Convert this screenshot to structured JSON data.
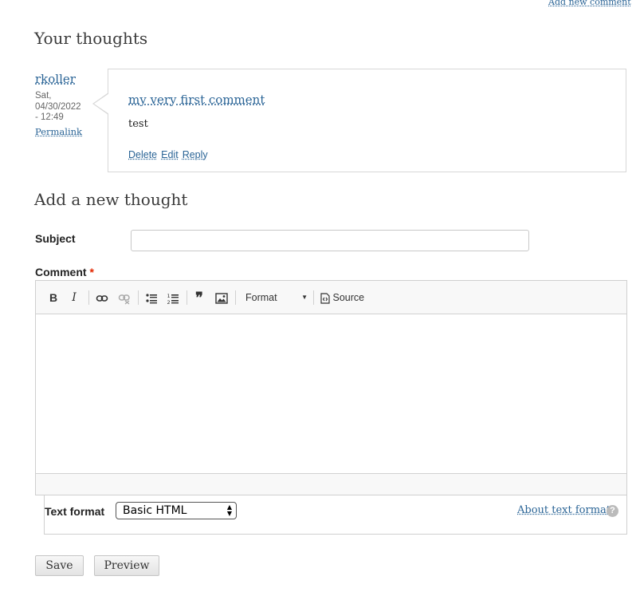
{
  "header": {
    "add_new_comment": "Add new comment"
  },
  "comments_section": {
    "title": "Your thoughts",
    "comment": {
      "author": "rkoller",
      "date_lines": [
        "Sat,",
        "04/30/2022",
        "- 12:49"
      ],
      "permalink": "Permalink",
      "title": "my very first comment",
      "body": "test",
      "actions": {
        "delete": "Delete",
        "edit": "Edit",
        "reply": "Reply"
      }
    }
  },
  "form": {
    "title": "Add a new thought",
    "subject_label": "Subject",
    "subject_value": "",
    "comment_label": "Comment",
    "required_marker": "*",
    "toolbar": {
      "bold": "B",
      "italic": "I",
      "format": "Format",
      "source": "Source",
      "blockquote": "❞"
    },
    "text_format_label": "Text format",
    "text_format_value": "Basic HTML",
    "about_text_formats": "About text formats",
    "help_glyph": "?",
    "save": "Save",
    "preview": "Preview"
  },
  "colors": {
    "link": "#2a6496",
    "required": "#e32700"
  }
}
